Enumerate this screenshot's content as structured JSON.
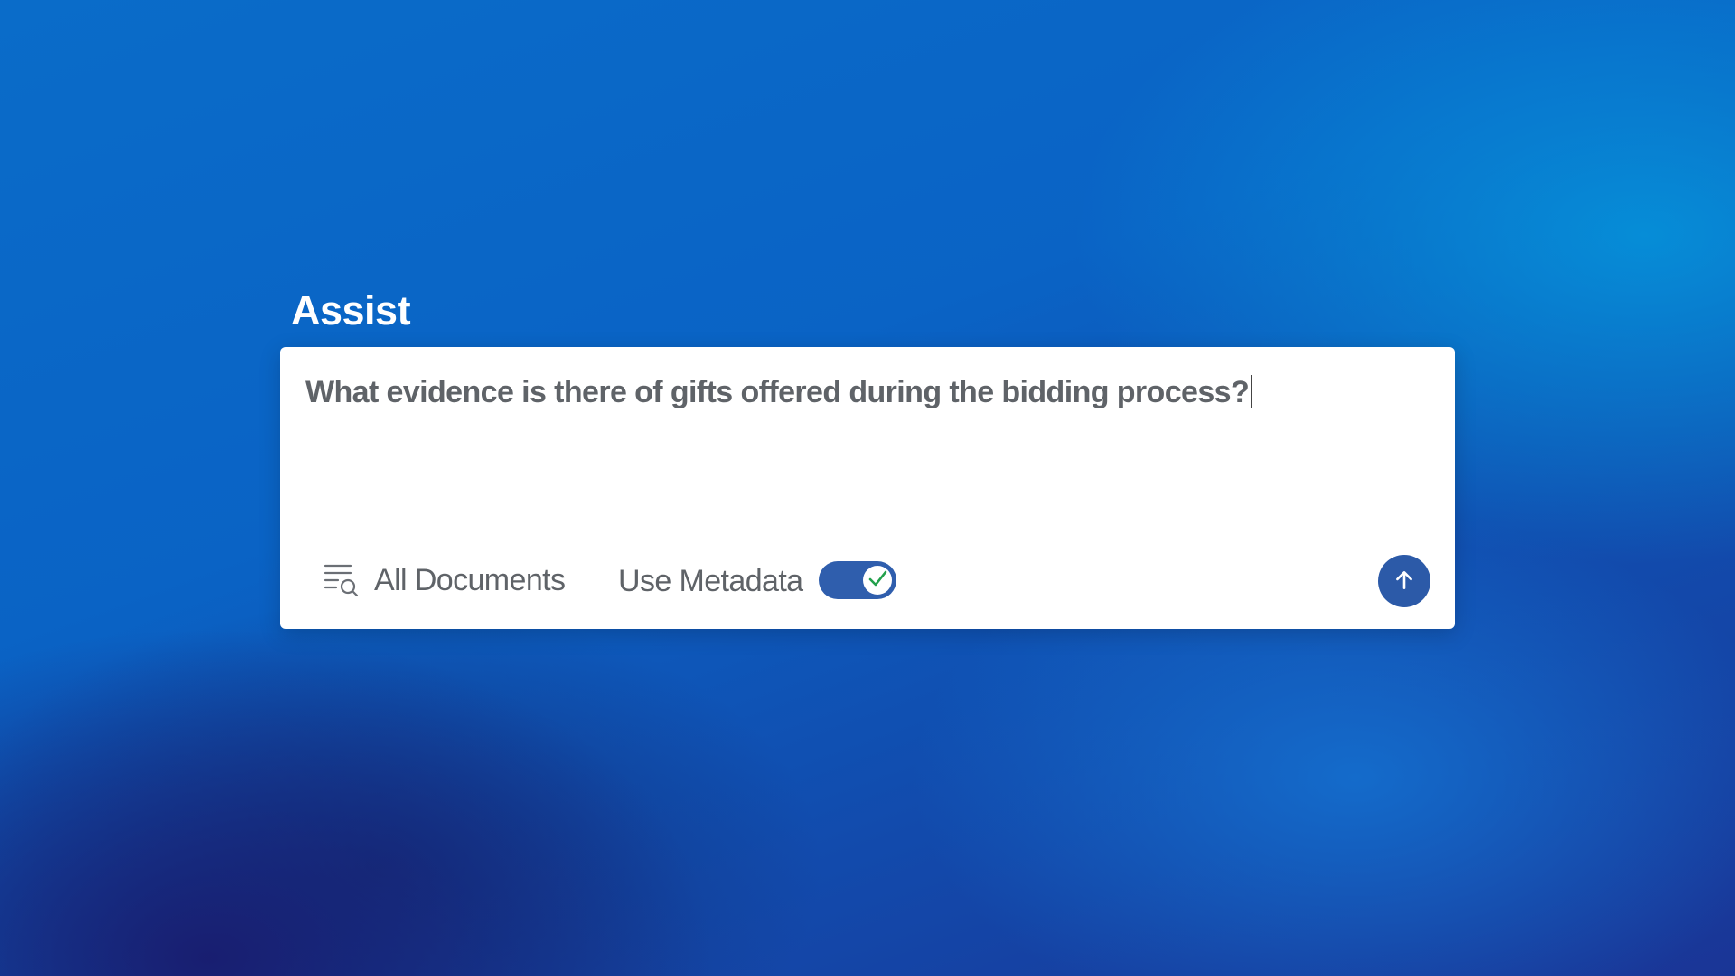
{
  "header": {
    "title": "Assist"
  },
  "query": {
    "value": "What evidence is there of gifts offered during the bidding process?"
  },
  "footer": {
    "document_filter": {
      "label": "All Documents",
      "icon": "document-search-icon"
    },
    "metadata_toggle": {
      "label": "Use Metadata",
      "checked": true,
      "icon": "checkmark-icon"
    },
    "send_button": {
      "icon": "arrow-up-icon"
    }
  },
  "colors": {
    "accent": "#2c5aa8",
    "toggle_check": "#22a04b",
    "text": "#5f6368"
  }
}
